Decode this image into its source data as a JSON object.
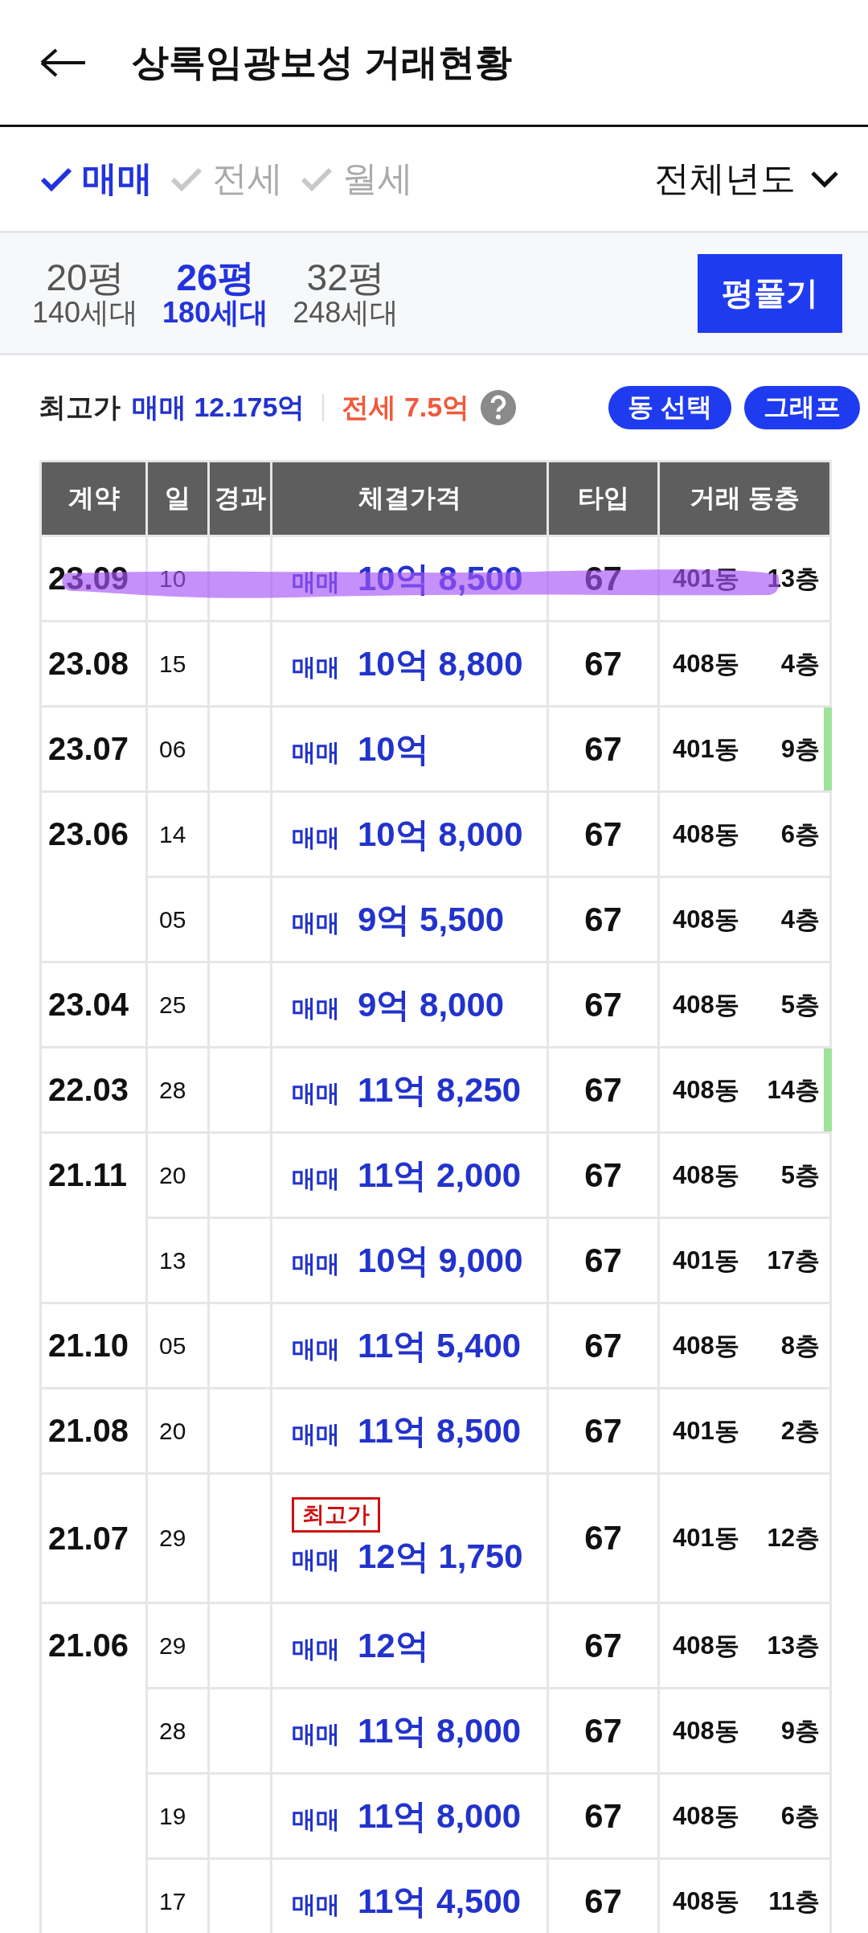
{
  "header": {
    "title": "상록임광보성 거래현황"
  },
  "deal_types": [
    {
      "label": "매매",
      "checked": true
    },
    {
      "label": "전세",
      "checked": false
    },
    {
      "label": "월세",
      "checked": false
    }
  ],
  "period": {
    "value": "전체년도"
  },
  "areas": [
    {
      "size": "20평",
      "households": "140세대",
      "selected": false
    },
    {
      "size": "26평",
      "households": "180세대",
      "selected": true
    },
    {
      "size": "32평",
      "households": "248세대",
      "selected": false
    }
  ],
  "area_button": "평풀기",
  "summary": {
    "label": "최고가",
    "sale": "매매 12.175억",
    "lease": "전세 7.5억",
    "buttons": [
      "동 선택",
      "그래프"
    ]
  },
  "table": {
    "columns": [
      "계약",
      "일",
      "경과",
      "체결가격",
      "타입",
      "거래 동층"
    ],
    "months": [
      {
        "month": "23.09",
        "deals": [
          {
            "day": "10",
            "kind": "매매",
            "price": "10억 8,500",
            "type": "67",
            "dong": "401동",
            "floor": "13층",
            "highest": false,
            "marked": false,
            "highlighted": true
          }
        ]
      },
      {
        "month": "23.08",
        "deals": [
          {
            "day": "15",
            "kind": "매매",
            "price": "10억 8,800",
            "type": "67",
            "dong": "408동",
            "floor": "4층",
            "highest": false,
            "marked": false,
            "highlighted": false
          }
        ]
      },
      {
        "month": "23.07",
        "deals": [
          {
            "day": "06",
            "kind": "매매",
            "price": "10억",
            "type": "67",
            "dong": "401동",
            "floor": "9층",
            "highest": false,
            "marked": true,
            "highlighted": false
          }
        ]
      },
      {
        "month": "23.06",
        "deals": [
          {
            "day": "14",
            "kind": "매매",
            "price": "10억 8,000",
            "type": "67",
            "dong": "408동",
            "floor": "6층",
            "highest": false,
            "marked": false,
            "highlighted": false
          },
          {
            "day": "05",
            "kind": "매매",
            "price": "9억 5,500",
            "type": "67",
            "dong": "408동",
            "floor": "4층",
            "highest": false,
            "marked": false,
            "highlighted": false
          }
        ]
      },
      {
        "month": "23.04",
        "deals": [
          {
            "day": "25",
            "kind": "매매",
            "price": "9억 8,000",
            "type": "67",
            "dong": "408동",
            "floor": "5층",
            "highest": false,
            "marked": false,
            "highlighted": false
          }
        ]
      },
      {
        "month": "22.03",
        "deals": [
          {
            "day": "28",
            "kind": "매매",
            "price": "11억 8,250",
            "type": "67",
            "dong": "408동",
            "floor": "14층",
            "highest": false,
            "marked": true,
            "highlighted": false
          }
        ]
      },
      {
        "month": "21.11",
        "deals": [
          {
            "day": "20",
            "kind": "매매",
            "price": "11억 2,000",
            "type": "67",
            "dong": "408동",
            "floor": "5층",
            "highest": false,
            "marked": false,
            "highlighted": false
          },
          {
            "day": "13",
            "kind": "매매",
            "price": "10억 9,000",
            "type": "67",
            "dong": "401동",
            "floor": "17층",
            "highest": false,
            "marked": false,
            "highlighted": false
          }
        ]
      },
      {
        "month": "21.10",
        "deals": [
          {
            "day": "05",
            "kind": "매매",
            "price": "11억 5,400",
            "type": "67",
            "dong": "408동",
            "floor": "8층",
            "highest": false,
            "marked": false,
            "highlighted": false
          }
        ]
      },
      {
        "month": "21.08",
        "deals": [
          {
            "day": "20",
            "kind": "매매",
            "price": "11억 8,500",
            "type": "67",
            "dong": "401동",
            "floor": "2층",
            "highest": false,
            "marked": false,
            "highlighted": false
          }
        ]
      },
      {
        "month": "21.07",
        "deals": [
          {
            "day": "29",
            "kind": "매매",
            "price": "12억 1,750",
            "type": "67",
            "dong": "401동",
            "floor": "12층",
            "highest": true,
            "badge": "최고가",
            "marked": false,
            "highlighted": false
          }
        ]
      },
      {
        "month": "21.06",
        "deals": [
          {
            "day": "29",
            "kind": "매매",
            "price": "12억",
            "type": "67",
            "dong": "408동",
            "floor": "13층",
            "highest": false,
            "marked": false,
            "highlighted": false
          },
          {
            "day": "28",
            "kind": "매매",
            "price": "11억 8,000",
            "type": "67",
            "dong": "408동",
            "floor": "9층",
            "highest": false,
            "marked": false,
            "highlighted": false
          },
          {
            "day": "19",
            "kind": "매매",
            "price": "11억 8,000",
            "type": "67",
            "dong": "408동",
            "floor": "6층",
            "highest": false,
            "marked": false,
            "highlighted": false
          },
          {
            "day": "17",
            "kind": "매매",
            "price": "11억 4,500",
            "type": "67",
            "dong": "408동",
            "floor": "11층",
            "highest": false,
            "marked": false,
            "highlighted": false
          }
        ]
      }
    ]
  }
}
